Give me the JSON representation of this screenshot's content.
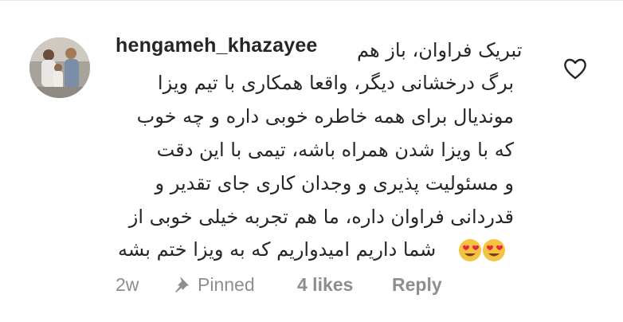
{
  "comment": {
    "username": "hengameh_khazayee",
    "lines": [
      "تبریک فراوان، باز هم",
      "برگ درخشانی دیگر، واقعا همکاری با تیم ویزا",
      "موندیال برای همه خاطره خوبی داره و چه خوب",
      "که با ویزا شدن همراه باشه، تیمی با این دقت",
      "و مسئولیت پذیری و وجدان کاری جای تقدیر و",
      "قدردانی فراوان داره، ما هم تجربه خیلی خوبی از",
      "شما داریم امیدواریم که به ویزا ختم بشه"
    ],
    "emoji": [
      "heart-eyes-emoji",
      "heart-eyes-emoji"
    ],
    "like_icon": "heart-outline-icon"
  },
  "meta": {
    "age": "2w",
    "pinned_icon": "pin-icon",
    "pinned_label": "Pinned",
    "likes": "4 likes",
    "reply": "Reply"
  },
  "colors": {
    "text": "#262626",
    "secondary": "#8e8e8e",
    "emoji_face": "#f5c342",
    "emoji_heart": "#e8253a"
  }
}
